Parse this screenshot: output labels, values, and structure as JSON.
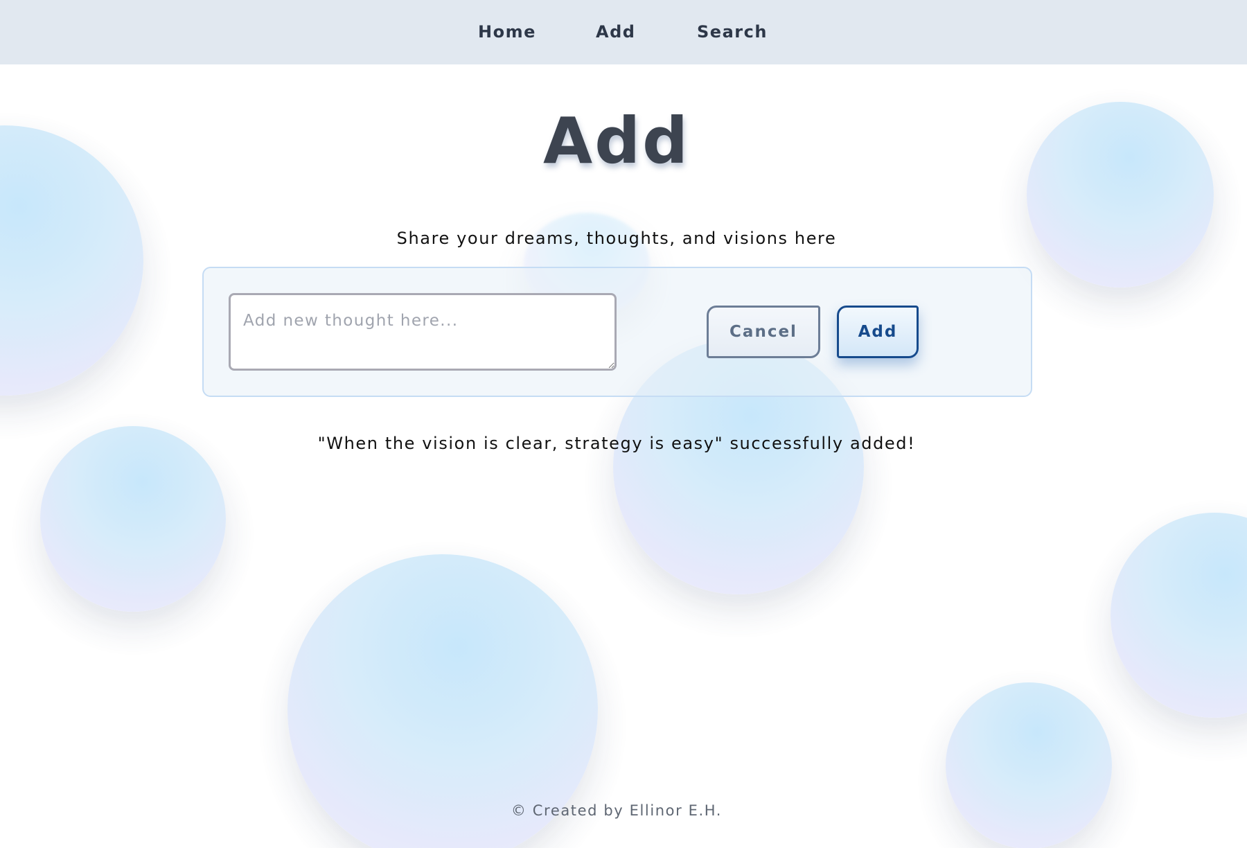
{
  "nav": {
    "home": "Home",
    "add": "Add",
    "search": "Search"
  },
  "page": {
    "title": "Add",
    "subtitle": "Share your dreams, thoughts, and visions here"
  },
  "form": {
    "thought_value": "",
    "thought_placeholder": "Add new thought here...",
    "cancel_label": "Cancel",
    "add_label": "Add"
  },
  "status": {
    "message": "\"When the vision is clear, strategy is easy\" successfully added!"
  },
  "footer": {
    "text": "© Created by Ellinor E.H."
  },
  "colors": {
    "navbar_bg": "#e1e8f0",
    "title_text": "#3d4450",
    "add_button_accent": "#164a8c",
    "cancel_button_accent": "#6c7d96",
    "bubble_blue": "#c3e6fb",
    "bubble_lavender": "#f3eefd"
  }
}
